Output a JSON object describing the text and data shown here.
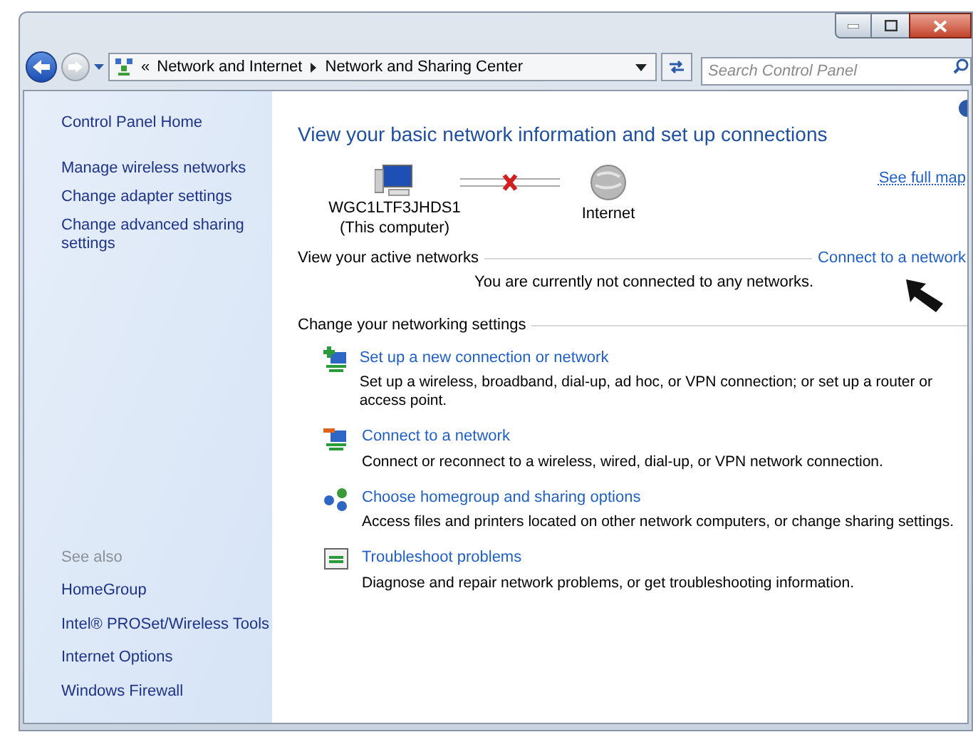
{
  "address_bar": {
    "overflow": "«",
    "breadcrumbs": [
      "Network and Internet",
      "Network and Sharing Center"
    ]
  },
  "search": {
    "placeholder": "Search Control Panel"
  },
  "sidebar": {
    "home": "Control Panel Home",
    "tasks": [
      "Manage wireless networks",
      "Change adapter settings",
      "Change advanced sharing settings"
    ],
    "see_also_heading": "See also",
    "see_also": [
      "HomeGroup",
      "Intel® PROSet/Wireless Tools",
      "Internet Options",
      "Windows Firewall"
    ]
  },
  "main": {
    "title": "View your basic network information and set up connections",
    "map": {
      "computer_name": "WGC1LTF3JHDS1",
      "computer_note": "(This computer)",
      "internet": "Internet",
      "connected": false,
      "see_full_map": "See full map"
    },
    "active_networks": {
      "heading": "View your active networks",
      "link": "Connect to a network",
      "message": "You are currently not connected to any networks."
    },
    "settings": {
      "heading": "Change your networking settings",
      "items": [
        {
          "kind": "new_connection",
          "title": "Set up a new connection or network",
          "description": "Set up a wireless, broadband, dial-up, ad hoc, or VPN connection; or set up a router or access point."
        },
        {
          "kind": "connect",
          "title": "Connect to a network",
          "description": "Connect or reconnect to a wireless, wired, dial-up, or VPN network connection."
        },
        {
          "kind": "homegroup",
          "title": "Choose homegroup and sharing options",
          "description": "Access files and printers located on other network computers, or change sharing settings."
        },
        {
          "kind": "troubleshoot",
          "title": "Troubleshoot problems",
          "description": "Diagnose and repair network problems, or get troubleshooting information."
        }
      ]
    }
  }
}
